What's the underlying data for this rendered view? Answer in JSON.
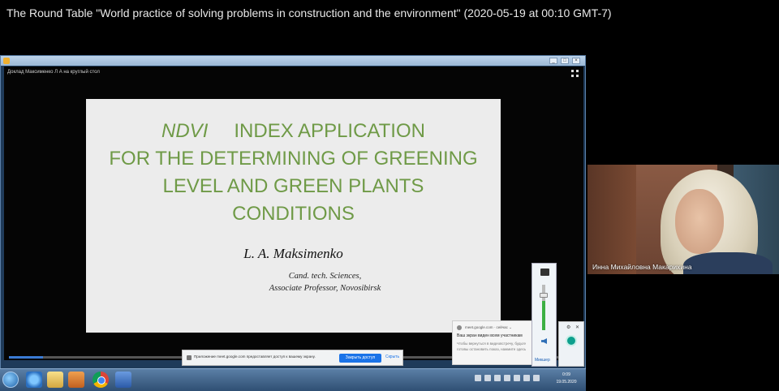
{
  "meeting": {
    "title": "The Round Table \"World practice of solving problems in construction and the environment\" (2020-05-19 at 00:10 GMT-7)"
  },
  "shared_window": {
    "caption": "Доклад Максименко Л А на круглый стол",
    "icons": [
      "window-app-icon",
      "minimize-icon",
      "maximize-icon",
      "close-icon",
      "fullscreen-icon"
    ]
  },
  "slide": {
    "title_ndvi": "NDVI",
    "title_rest": "INDEX APPLICATION",
    "title_line2": "FOR THE DETERMINING OF GREENING",
    "title_line3": "LEVEL AND GREEN PLANTS",
    "title_line4": "CONDITIONS",
    "author": "L. A. Maksimenko",
    "line1": "Cand. tech. Sciences,",
    "line2": "Associate Professor, Novosibirsk",
    "title_color": "#6f9a47"
  },
  "video": {
    "progress": 0.06
  },
  "share_bar": {
    "message": "Приложение meet.google.com предоставляет доступ к вашему экрану.",
    "stop_label": "Закрыть доступ",
    "hide_label": "Скрыть",
    "stop_color": "#1a73e8"
  },
  "notification": {
    "source": "meet.google.com  ·  сейчас  ⌄",
    "title": "Ваш экран виден всем участникам",
    "body": "Чтобы вернуться в видеовстречу, будьте готовы остановить показ, нажмите здесь"
  },
  "volume": {
    "level": 0.65,
    "mixer_label": "Микшер"
  },
  "taskbar": {
    "apps": [
      "start-button",
      "internet-explorer-icon",
      "file-explorer-icon",
      "media-player-icon",
      "chrome-icon",
      "word-icon"
    ],
    "clock_time": "0:09",
    "clock_date": "19.05.2020"
  },
  "participant": {
    "name": "Инна Михайловна Макарихина"
  }
}
